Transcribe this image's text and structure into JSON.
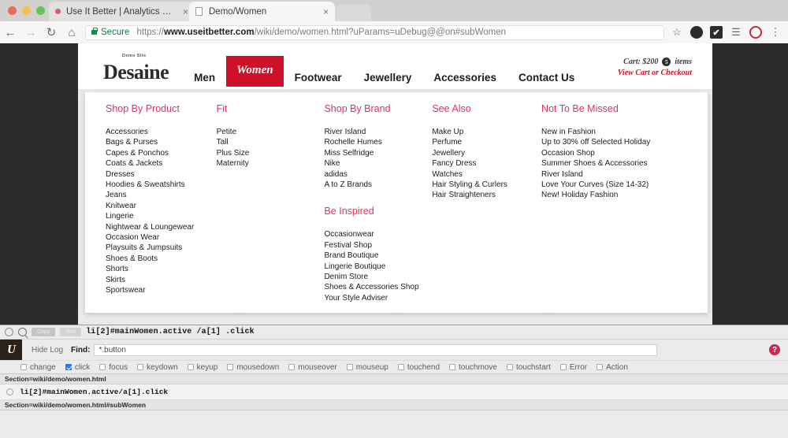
{
  "browser": {
    "tabs": [
      {
        "title": "Use It Better | Analytics Panel",
        "close": "×",
        "active": false
      },
      {
        "title": "Demo/Women",
        "close": "×",
        "active": true
      }
    ],
    "nav": {
      "back": "←",
      "forward": "→",
      "reload": "↻",
      "home": "⌂",
      "star": "☆",
      "menu": "⋮",
      "extension_label": "✔",
      "stack_icon": "☰",
      "security_label": "Secure",
      "url_scheme": "https://",
      "url_domain": "www.useitbetter.com",
      "url_path": "/wiki/demo/women.html?uParams=uDebug@@on#subWomen"
    }
  },
  "site": {
    "logo_sub": "Demo Site",
    "logo_text": "Desaine",
    "nav_items": [
      {
        "label": "Men",
        "active": false
      },
      {
        "label": "Women",
        "active": true
      },
      {
        "label": "Footwear",
        "active": false
      },
      {
        "label": "Jewellery",
        "active": false
      },
      {
        "label": "Accessories",
        "active": false
      },
      {
        "label": "Contact Us",
        "active": false
      }
    ],
    "cart": {
      "label": "Cart: $200",
      "count": "5",
      "items_label": "items",
      "checkout_link": "View Cart or Checkout"
    },
    "megamenu": {
      "col1": {
        "title": "Shop By Product",
        "links": [
          "Accessories",
          "Bags & Purses",
          "Capes & Ponchos",
          "Coats & Jackets",
          "Dresses",
          "Hoodies & Sweatshirts",
          "Jeans",
          "Knitwear",
          "Lingerie",
          "Nightwear & Loungewear",
          "Occasion Wear",
          "Playsuits & Jumpsuits",
          "Shoes & Boots",
          "Shorts",
          "Skirts",
          "Sportswear"
        ]
      },
      "col2": {
        "title": "Fit",
        "links": [
          "Petite",
          "Tall",
          "Plus Size",
          "Maternity"
        ]
      },
      "col3": {
        "title": "Shop By Brand",
        "links": [
          "River Island",
          "Rochelle Humes",
          "Miss Selfridge",
          "Nike",
          "adidas",
          "A to Z Brands"
        ],
        "title2": "Be Inspired",
        "links2": [
          "Occasionwear",
          "Festival Shop",
          "Brand Boutique",
          "Lingerie Boutique",
          "Denim Store",
          "Shoes & Accessories Shop",
          "Your Style Adviser"
        ]
      },
      "col4": {
        "title": "See Also",
        "links": [
          "Make Up",
          "Perfume",
          "Jewellery",
          "Fancy Dress",
          "Watches",
          "Hair Styling & Curlers",
          "Hair Straighteners"
        ]
      },
      "col5": {
        "title": "Not To Be Missed",
        "links": [
          "New in Fashion",
          "Up to 30% off Selected Holiday",
          "Occasion Shop",
          "Summer Shoes & Accessories",
          "River Island",
          "Love Your Curves (Size 14-32)",
          "New! Holiday Fashion"
        ]
      }
    }
  },
  "panel": {
    "copy_button": "Copy",
    "run_button": "Run",
    "selector": "li[2]#mainWomen.active /a[1] .click",
    "brand_mark": "U",
    "hide_log": "Hide Log",
    "find_label": "Find:",
    "find_value": "*.button",
    "help": "?",
    "filters": [
      {
        "label": "change",
        "checked": false
      },
      {
        "label": "click",
        "checked": true
      },
      {
        "label": "focus",
        "checked": false
      },
      {
        "label": "keydown",
        "checked": false
      },
      {
        "label": "keyup",
        "checked": false
      },
      {
        "label": "mousedown",
        "checked": false
      },
      {
        "label": "mouseover",
        "checked": false
      },
      {
        "label": "mouseup",
        "checked": false
      },
      {
        "label": "touchend",
        "checked": false
      },
      {
        "label": "touchmove",
        "checked": false
      },
      {
        "label": "touchstart",
        "checked": false
      },
      {
        "label": "Error",
        "checked": false
      },
      {
        "label": "Action",
        "checked": false
      }
    ],
    "log": {
      "section1": "Section=wiki/demo/women.html",
      "event1": "li[2]#mainWomen.active/a[1].click",
      "section2": "Section=wiki/demo/women.html#subWomen"
    }
  },
  "colors": {
    "accent_red": "#cc1128",
    "menu_pink": "#e0315c",
    "secure_green": "#0f7c47"
  }
}
